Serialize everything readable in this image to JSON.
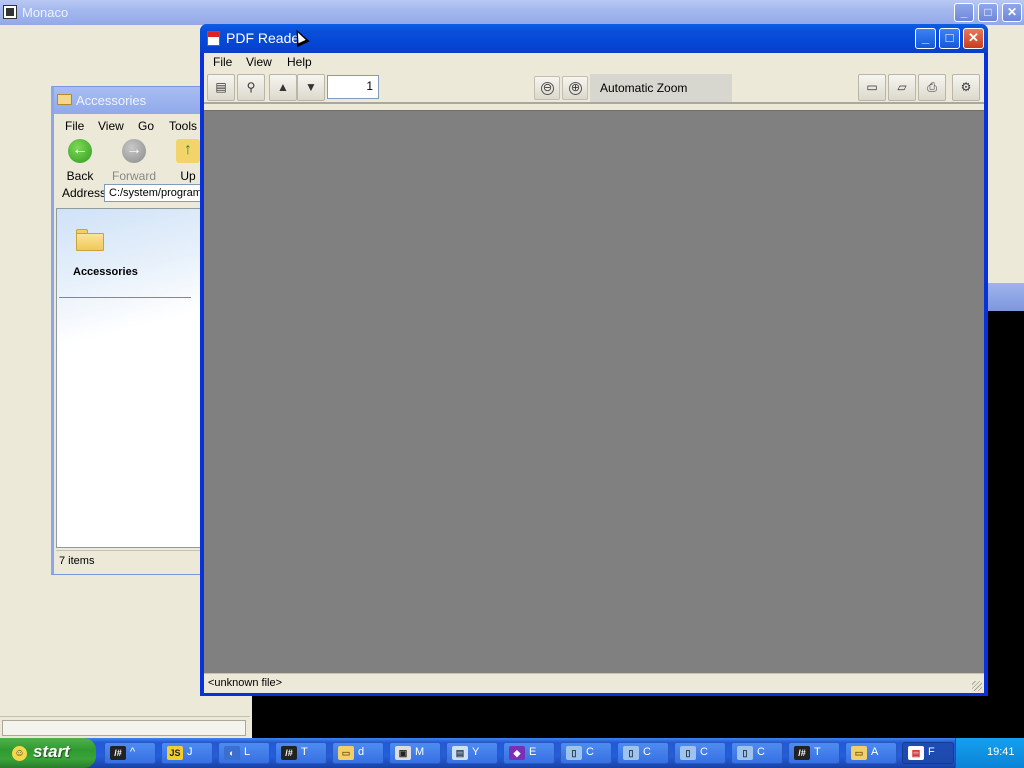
{
  "monaco": {
    "title": "Monaco",
    "min": "_",
    "max": "□",
    "close": "✕"
  },
  "explorer": {
    "title": "Accessories",
    "menu": [
      "File",
      "View",
      "Go",
      "Tools"
    ],
    "nav": {
      "back": "Back",
      "forward": "Forward",
      "up": "Up"
    },
    "address_label": "Address",
    "address_value": "C:/system/programs",
    "folder_label": "Accessories",
    "status": "7 items"
  },
  "pdf": {
    "title": "PDF Reader",
    "menu": [
      "File",
      "View",
      "Help"
    ],
    "page_value": "1",
    "zoom_out": "⊖",
    "zoom_in": "⊕",
    "zoom_label": "Automatic Zoom",
    "status": "<unknown file>",
    "min": "_",
    "max": "□",
    "close": "✕"
  },
  "taskbar": {
    "start": "start",
    "items": [
      {
        "icon": "terminal-icon",
        "glyph": "/#",
        "label": "^"
      },
      {
        "icon": "js-icon",
        "glyph": "JS",
        "label": "J"
      },
      {
        "icon": "globe-icon",
        "glyph": "◐",
        "label": "L"
      },
      {
        "icon": "terminal-icon",
        "glyph": "/#",
        "label": "T"
      },
      {
        "icon": "folder-icon",
        "glyph": "▭",
        "label": "d"
      },
      {
        "icon": "monaco-icon",
        "glyph": "▣",
        "label": "M"
      },
      {
        "icon": "document-icon",
        "glyph": "▤",
        "label": "Y"
      },
      {
        "icon": "gem-icon",
        "glyph": "◆",
        "label": "E"
      },
      {
        "icon": "disk-icon",
        "glyph": "▯",
        "label": "C"
      },
      {
        "icon": "disk-icon",
        "glyph": "▯",
        "label": "C"
      },
      {
        "icon": "disk-icon",
        "glyph": "▯",
        "label": "C"
      },
      {
        "icon": "disk-icon",
        "glyph": "▯",
        "label": "C"
      },
      {
        "icon": "terminal-icon",
        "glyph": "/#",
        "label": "T"
      },
      {
        "icon": "folder-icon",
        "glyph": "▭",
        "label": "A"
      },
      {
        "icon": "pdf-icon",
        "glyph": "▤",
        "label": "F"
      }
    ],
    "clock": "19:41"
  }
}
